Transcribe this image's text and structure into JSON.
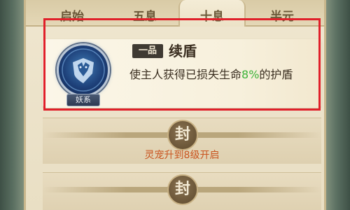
{
  "tabs": [
    {
      "label": "启始",
      "active": false
    },
    {
      "label": "五息",
      "active": false
    },
    {
      "label": "十息",
      "active": true
    },
    {
      "label": "半元",
      "active": false
    }
  ],
  "skill": {
    "icon": "wolf-emblem-icon",
    "tag": "妖系",
    "grade": "一品",
    "name": "续盾",
    "desc_prefix": "使主人获得已损失生命",
    "desc_value": "8%",
    "desc_suffix": "的护盾",
    "value_color": "#3db33a"
  },
  "locked_slots": [
    {
      "seal": "封",
      "unlock_text": "灵宠升到8级开启"
    },
    {
      "seal": "封",
      "unlock_text": ""
    }
  ],
  "highlight_color": "#e0202a"
}
